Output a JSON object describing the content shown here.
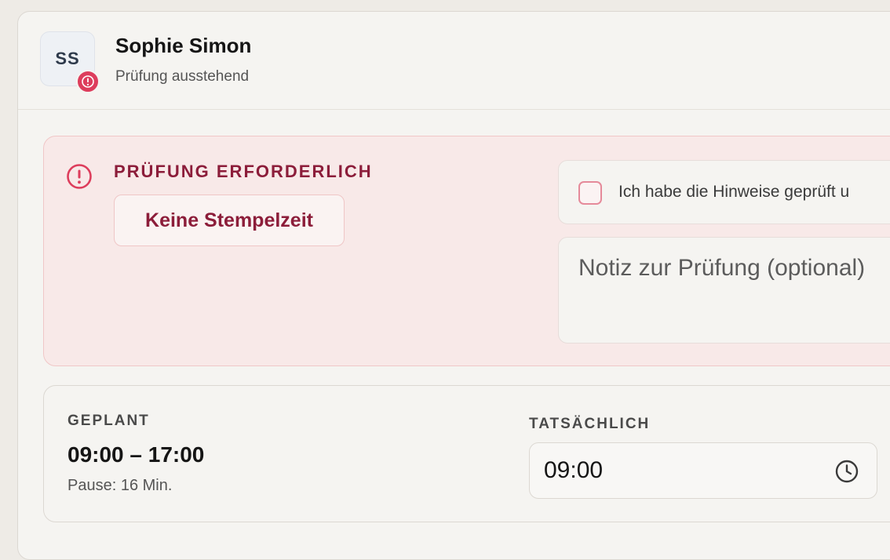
{
  "employee": {
    "initials": "SS",
    "name": "Sophie Simon",
    "status": "Prüfung ausstehend"
  },
  "alert": {
    "title": "PRÜFUNG ERFORDERLICH",
    "issue": "Keine Stempelzeit",
    "confirm_label": "Ich habe die Hinweise geprüft u",
    "note_placeholder": "Notiz zur Prüfung (optional)"
  },
  "times": {
    "planned_label": "GEPLANT",
    "planned_value": "09:00 – 17:00",
    "pause": "Pause: 16 Min.",
    "actual_label": "TATSÄCHLICH",
    "actual_value": "09:00"
  },
  "colors": {
    "accent": "#dd3d5c",
    "alert_text": "#8c1d3a",
    "alert_bg": "#f8e9e8"
  },
  "icons": {
    "avatar_badge": "exclamation-icon",
    "alert": "exclamation-circle-icon",
    "time": "clock-icon"
  }
}
